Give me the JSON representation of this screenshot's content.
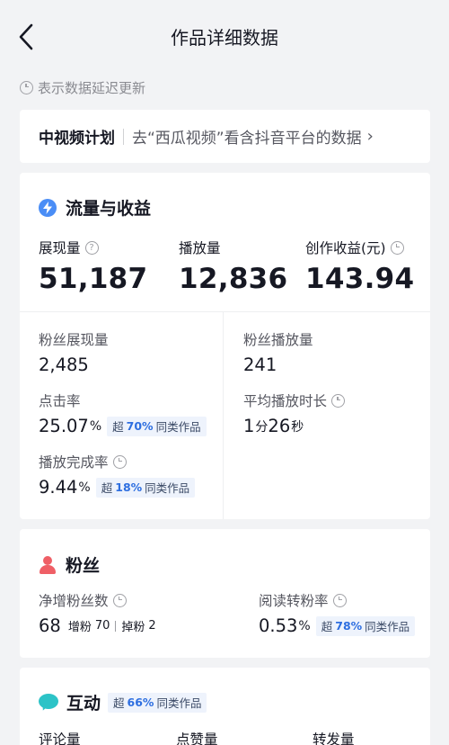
{
  "nav": {
    "title": "作品详细数据",
    "back_icon": "chevron-left-icon"
  },
  "notice": {
    "text": "表示数据延迟更新",
    "icon": "clock-icon"
  },
  "plan": {
    "title": "中视频计划",
    "link_text": "去“西瓜视频”看含抖音平台的数据",
    "chevron": "›"
  },
  "traffic": {
    "title": "流量与收益",
    "icon": "bolt-icon",
    "kpis": [
      {
        "label": "展现量",
        "value": "51,187"
      },
      {
        "label": "播放量",
        "value": "12,836"
      },
      {
        "label": "创作收益(元)",
        "value": "143.94"
      }
    ],
    "fan_impressions": {
      "label": "粉丝展现量",
      "value": "2,485"
    },
    "fan_plays": {
      "label": "粉丝播放量",
      "value": "241"
    },
    "ctr": {
      "label": "点击率",
      "value": "25.07",
      "unit": "%",
      "badge_prefix": "超",
      "badge_pct": "70%",
      "badge_suffix": "同类作品"
    },
    "avg_duration": {
      "label": "平均播放时长",
      "min_value": "1",
      "min_unit": "分",
      "sec_value": "26",
      "sec_unit": "秒"
    },
    "completion": {
      "label": "播放完成率",
      "value": "9.44",
      "unit": "%",
      "badge_prefix": "超",
      "badge_pct": "18%",
      "badge_suffix": "同类作品"
    }
  },
  "fans": {
    "title": "粉丝",
    "icon": "person-icon",
    "net_gain": {
      "label": "净增粉丝数",
      "value": "68",
      "gain_label": "增粉",
      "gain_value": "70",
      "loss_label": "掉粉",
      "loss_value": "2"
    },
    "conversion": {
      "label": "阅读转粉率",
      "value": "0.53",
      "unit": "%",
      "badge_prefix": "超",
      "badge_pct": "78%",
      "badge_suffix": "同类作品"
    }
  },
  "interaction": {
    "title": "互动",
    "icon": "chat-bubble-icon",
    "badge_prefix": "超",
    "badge_pct": "66%",
    "badge_suffix": "同类作品",
    "columns": [
      "评论量",
      "点赞量",
      "转发量"
    ]
  },
  "colors": {
    "accent_blue": "#2e6fe0",
    "bolt_blue": "#4a8df6",
    "fans_red": "#ef5f66",
    "chat_teal": "#2cc3c7",
    "background": "#f2f3f5"
  }
}
